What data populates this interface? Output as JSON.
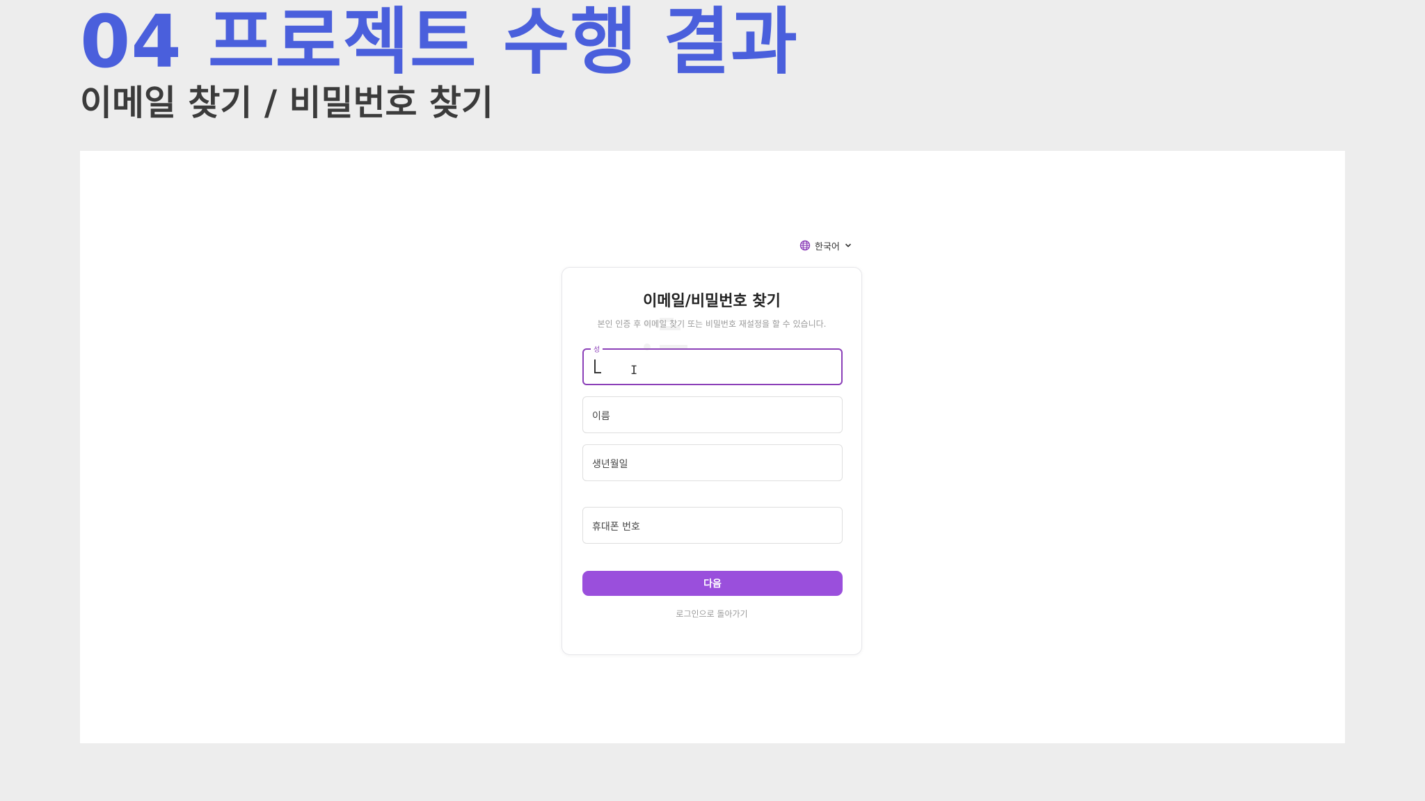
{
  "slide": {
    "title": "04 프로젝트 수행 결과",
    "subtitle": "이메일 찾기 / 비밀번호 찾기"
  },
  "header": {
    "language_label": "한국어",
    "language_icon": "globe-icon",
    "dropdown_icon": "chevron-down-icon"
  },
  "card": {
    "title": "이메일/비밀번호 찾기",
    "description": "본인 인증 후 이메일 찾기 또는 비밀번호 재설정을 할 수 있습니다."
  },
  "form": {
    "last_name_label": "성",
    "last_name_value": "",
    "first_name_placeholder": "이름",
    "birthdate_placeholder": "생년월일",
    "phone_placeholder": "휴대폰 번호",
    "next_button": "다음",
    "back_link": "로그인으로 돌아가기"
  },
  "colors": {
    "title_blue": "#4a5fdc",
    "accent_purple": "#9a4fdc",
    "focus_border": "#8b3fb8"
  }
}
